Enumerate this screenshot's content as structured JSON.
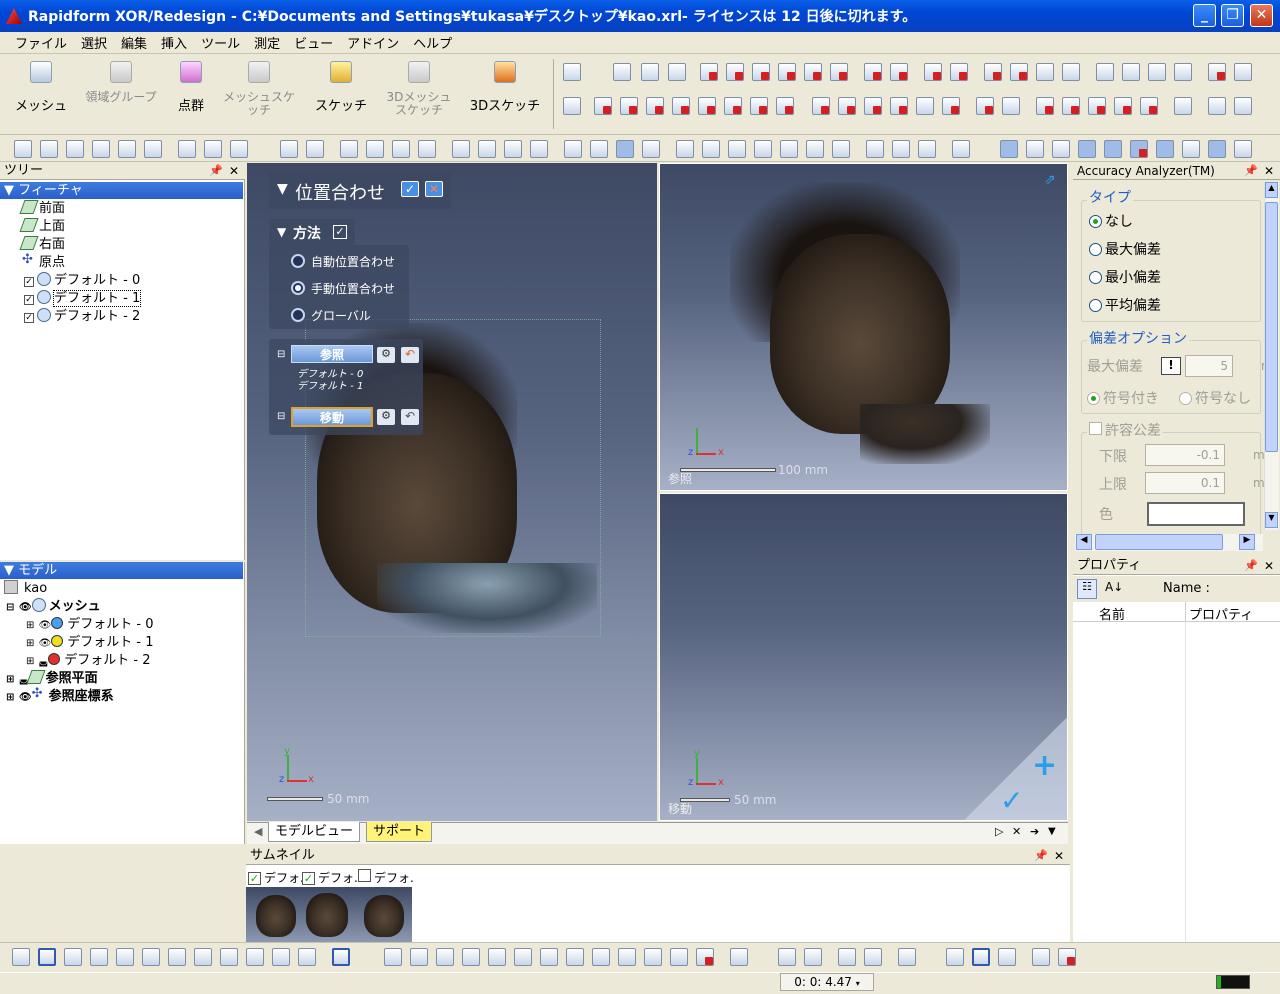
{
  "window": {
    "title": "Rapidform XOR/Redesign - C:¥Documents and Settings¥tukasa¥デスクトップ¥kao.xrl- ライセンスは 12 日後に切れます。"
  },
  "menu": [
    "ファイル",
    "選択",
    "編集",
    "挿入",
    "ツール",
    "測定",
    "ビュー",
    "アドイン",
    "ヘルプ"
  ],
  "bigtools": [
    {
      "label": "メッシュ",
      "enabled": true,
      "icon": "mesh-icon"
    },
    {
      "label": "領域グループ",
      "enabled": false,
      "icon": "region-group-icon"
    },
    {
      "label": "点群",
      "enabled": true,
      "icon": "point-cloud-icon"
    },
    {
      "label": "メッシュスケッチ",
      "enabled": false,
      "icon": "mesh-sketch-icon"
    },
    {
      "label": "スケッチ",
      "enabled": true,
      "icon": "sketch-icon"
    },
    {
      "label": "3Dメッシュスケッチ",
      "enabled": false,
      "icon": "3d-mesh-sketch-icon"
    },
    {
      "label": "3Dスケッチ",
      "enabled": true,
      "icon": "3d-sketch-icon"
    }
  ],
  "tree_panel": {
    "title": "ツリー",
    "section": "フィーチャ",
    "items": [
      "前面",
      "上面",
      "右面",
      "原点",
      "デフォルト - 0",
      "デフォルト - 1",
      "デフォルト - 2"
    ]
  },
  "model_panel": {
    "section": "モデル",
    "root": "kao",
    "mesh_group": "メッシュ",
    "meshes": [
      {
        "label": "デフォルト - 0",
        "color": "#4a9ff0"
      },
      {
        "label": "デフォルト - 1",
        "color": "#f0e020"
      },
      {
        "label": "デフォルト - 2",
        "color": "#e03030"
      }
    ],
    "ref_planes": "参照平面",
    "ref_coords": "参照座標系"
  },
  "align_dialog": {
    "title": "位置合わせ",
    "method_title": "方法",
    "options": [
      {
        "label": "自動位置合わせ",
        "selected": false
      },
      {
        "label": "手動位置合わせ",
        "selected": true
      },
      {
        "label": "グローバル",
        "selected": false
      }
    ],
    "reference_label": "参照",
    "reference_items": [
      "デフォルト - 0",
      "デフォルト - 1"
    ],
    "move_label": "移動"
  },
  "viewports": {
    "main": {
      "scale": "50 mm"
    },
    "ref": {
      "name": "参照",
      "scale": "100 mm"
    },
    "move": {
      "name": "移動",
      "scale": "50 mm"
    }
  },
  "view_tabs": [
    "モデルビュー",
    "サポート"
  ],
  "thumbnail": {
    "title": "サムネイル",
    "items": [
      {
        "label": "デフォ.",
        "checked": true
      },
      {
        "label": "デフォ.",
        "checked": true
      },
      {
        "label": "デフォ.",
        "checked": false
      }
    ]
  },
  "accuracy": {
    "title": "Accuracy Analyzer(TM)",
    "type_group": "タイプ",
    "types": [
      {
        "label": "なし",
        "selected": true
      },
      {
        "label": "最大偏差",
        "selected": false
      },
      {
        "label": "最小偏差",
        "selected": false
      },
      {
        "label": "平均偏差",
        "selected": false
      }
    ],
    "dev_group": "偏差オプション",
    "max_dev_label": "最大偏差",
    "max_dev_value": "5",
    "max_dev_unit": "m",
    "signed": "符号付き",
    "unsigned": "符号なし",
    "tolerance_label": "許容公差",
    "lower_label": "下限",
    "lower_value": "-0.1",
    "upper_label": "上限",
    "upper_value": "0.1",
    "unit": "mm",
    "color_label": "色"
  },
  "properties": {
    "title": "プロパティ",
    "name_label": "Name :",
    "col_name": "名前",
    "col_prop": "プロパティ"
  },
  "status": {
    "time": "0: 0: 4.47"
  }
}
